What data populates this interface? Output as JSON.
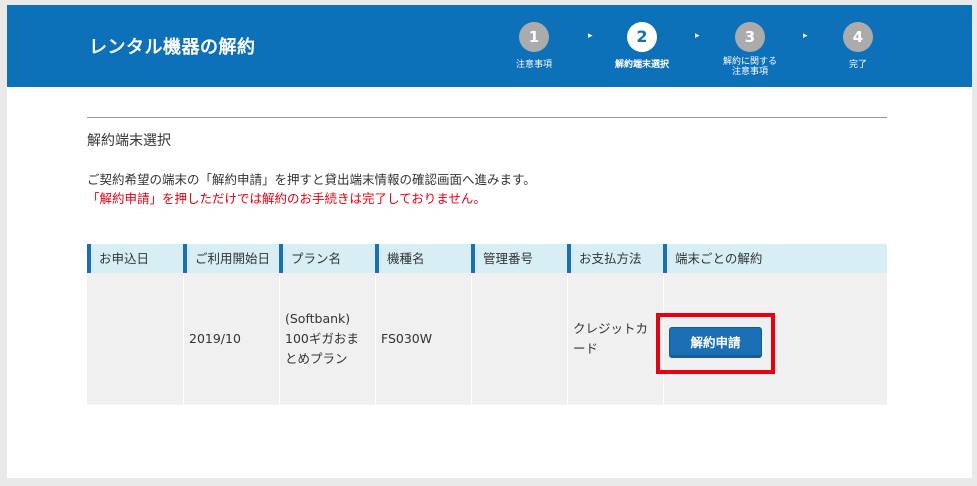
{
  "header": {
    "title": "レンタル機器の解約",
    "steps": [
      {
        "number": "1",
        "label_line1": "注意事項",
        "label_line2": ""
      },
      {
        "number": "2",
        "label_line1": "解約端末選択",
        "label_line2": ""
      },
      {
        "number": "3",
        "label_line1": "解約に関する",
        "label_line2": "注意事項"
      },
      {
        "number": "4",
        "label_line1": "完了",
        "label_line2": ""
      }
    ],
    "active_step": 2,
    "separator": "▸"
  },
  "section": {
    "title": "解約端末選択",
    "instruction": "ご契約希望の端末の「解約申請」を押すと貸出端末情報の確認画面へ進みます。",
    "warning": "「解約申請」を押しただけでは解約のお手続きは完了しておりません。"
  },
  "table": {
    "headers": [
      "お申込日",
      "ご利用開始日",
      "プラン名",
      "機種名",
      "管理番号",
      "お支払方法",
      "端末ごとの解約"
    ],
    "row": {
      "apply_date": "",
      "start_date": "2019/10",
      "plan": "(Softbank) 100ギガおまとめプラン",
      "model": "FS030W",
      "management_no": "",
      "payment": "クレジットカード",
      "action_label": "解約申請"
    }
  },
  "colors": {
    "header_bg": "#0d71b9",
    "accent": "#1a6fb5",
    "warning": "#e60012",
    "table_header_bg": "#d7eef5",
    "table_row_bg": "#f0f0f0"
  }
}
